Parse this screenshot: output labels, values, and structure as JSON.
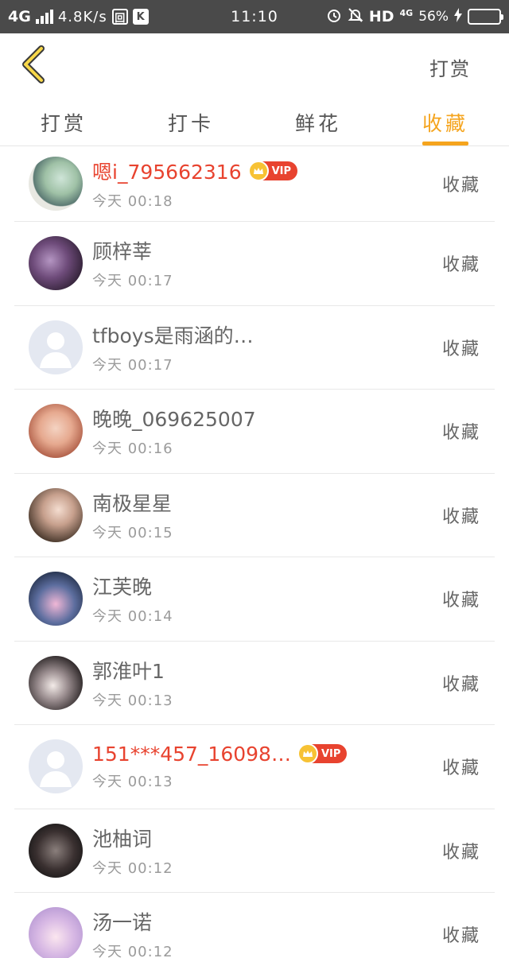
{
  "status_bar": {
    "network": "4G",
    "speed": "4.8K/s",
    "time": "11:10",
    "hd": "HD",
    "net_small": "4G",
    "battery": "56%",
    "battery_level": 0.56
  },
  "header": {
    "action_label": "打赏"
  },
  "tabs": [
    {
      "label": "打赏",
      "active": false
    },
    {
      "label": "打卡",
      "active": false
    },
    {
      "label": "鲜花",
      "active": false
    },
    {
      "label": "收藏",
      "active": true
    }
  ],
  "accent_color": "#f5a41d",
  "vip_color": "#e8432f",
  "vip_label": "VIP",
  "items": [
    {
      "name": "嗯i_795662316",
      "time": "今天 00:18",
      "vip": true,
      "action": "收藏"
    },
    {
      "name": "顾梓莘",
      "time": "今天 00:17",
      "vip": false,
      "action": "收藏"
    },
    {
      "name": "tfboys是雨涵的…",
      "time": "今天 00:17",
      "vip": false,
      "action": "收藏"
    },
    {
      "name": "晚晚_069625007",
      "time": "今天 00:16",
      "vip": false,
      "action": "收藏"
    },
    {
      "name": "南极星星",
      "time": "今天 00:15",
      "vip": false,
      "action": "收藏"
    },
    {
      "name": "江芙晚",
      "time": "今天 00:14",
      "vip": false,
      "action": "收藏"
    },
    {
      "name": "郭淮叶1",
      "time": "今天 00:13",
      "vip": false,
      "action": "收藏"
    },
    {
      "name": "151***457_16098…",
      "time": "今天 00:13",
      "vip": true,
      "action": "收藏"
    },
    {
      "name": "池柚词",
      "time": "今天 00:12",
      "vip": false,
      "action": "收藏"
    },
    {
      "name": "汤一诺",
      "time": "今天 00:12",
      "vip": false,
      "action": "收藏"
    }
  ]
}
